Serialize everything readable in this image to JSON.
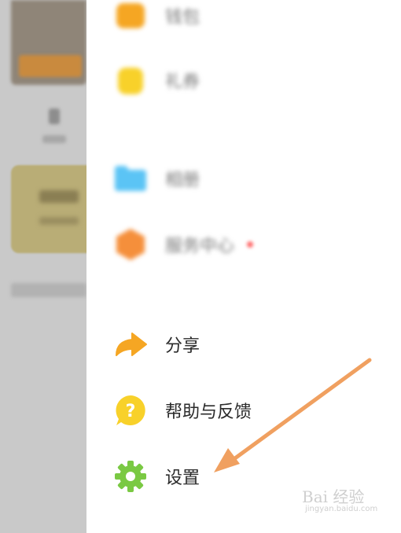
{
  "drawer": {
    "items": [
      {
        "label": "钱包",
        "icon": "wallet-icon",
        "color": "#f5a623"
      },
      {
        "label": "礼券",
        "icon": "coupon-icon",
        "color": "#f8d12a"
      },
      {
        "label": "相册",
        "icon": "folder-icon",
        "color": "#5bc4f5"
      },
      {
        "label": "服务中心",
        "icon": "service-icon",
        "color": "#f58f3b"
      },
      {
        "label": "分享",
        "icon": "share-arrow-icon",
        "color": "#f5a623"
      },
      {
        "label": "帮助与反馈",
        "icon": "help-question-icon",
        "color": "#f8d12a"
      },
      {
        "label": "设置",
        "icon": "gear-icon",
        "color": "#7ac943"
      }
    ]
  },
  "annotation": {
    "color": "#f0a060"
  },
  "watermark": {
    "text": "Bai 经验",
    "sub": "jingyan.baidu.com"
  }
}
